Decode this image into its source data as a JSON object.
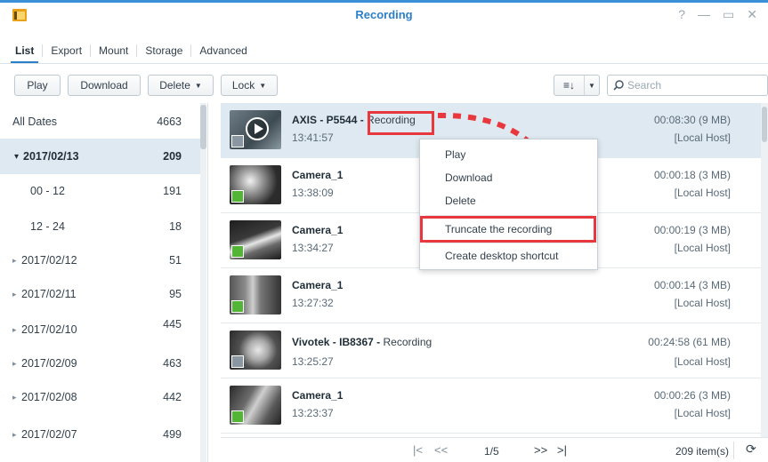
{
  "window": {
    "title": "Recording"
  },
  "tabs": [
    {
      "label": "List"
    },
    {
      "label": "Export"
    },
    {
      "label": "Mount"
    },
    {
      "label": "Storage"
    },
    {
      "label": "Advanced"
    }
  ],
  "toolbar": {
    "play": "Play",
    "download": "Download",
    "delete": "Delete",
    "lock": "Lock",
    "search_placeholder": "Search"
  },
  "sidebar": [
    {
      "label": "All Dates",
      "count": "4663"
    },
    {
      "label": "2017/02/13",
      "count": "209",
      "expanded": true,
      "selected": true
    },
    {
      "label": "00 - 12",
      "count": "191"
    },
    {
      "label": "12 - 24",
      "count": "18"
    },
    {
      "label": "2017/02/12",
      "count": "51"
    },
    {
      "label": "2017/02/11",
      "count": "95"
    },
    {
      "label": "2017/02/10",
      "count": "445"
    },
    {
      "label": "2017/02/09",
      "count": "463"
    },
    {
      "label": "2017/02/08",
      "count": "442"
    },
    {
      "label": "2017/02/07",
      "count": "499"
    }
  ],
  "recordings": [
    {
      "name": "AXIS - P5544",
      "suffix": "Recording",
      "time": "13:41:57",
      "duration": "00:08:30 (9 MB)",
      "host": "[Local Host]",
      "badge": "gray",
      "selected": true
    },
    {
      "name": "Camera_1",
      "suffix": "",
      "time": "13:38:09",
      "duration": "00:00:18 (3 MB)",
      "host": "[Local Host]",
      "badge": "green"
    },
    {
      "name": "Camera_1",
      "suffix": "",
      "time": "13:34:27",
      "duration": "00:00:19 (3 MB)",
      "host": "[Local Host]",
      "badge": "green"
    },
    {
      "name": "Camera_1",
      "suffix": "",
      "time": "13:27:32",
      "duration": "00:00:14 (3 MB)",
      "host": "[Local Host]",
      "badge": "green"
    },
    {
      "name": "Vivotek - IB8367",
      "suffix": "Recording",
      "time": "13:25:27",
      "duration": "00:24:58 (61 MB)",
      "host": "[Local Host]",
      "badge": "gray"
    },
    {
      "name": "Camera_1",
      "suffix": "",
      "time": "13:23:37",
      "duration": "00:00:26 (3 MB)",
      "host": "[Local Host]",
      "badge": "green"
    }
  ],
  "context_menu": [
    "Play",
    "Download",
    "Delete",
    "Truncate the recording",
    "Create desktop shortcut"
  ],
  "pager": {
    "page": "1/5",
    "count": "209 item(s)"
  },
  "colors": {
    "accent": "#2c7fc9",
    "highlight": "#e8383d",
    "selected_row": "#dfe9f1"
  }
}
